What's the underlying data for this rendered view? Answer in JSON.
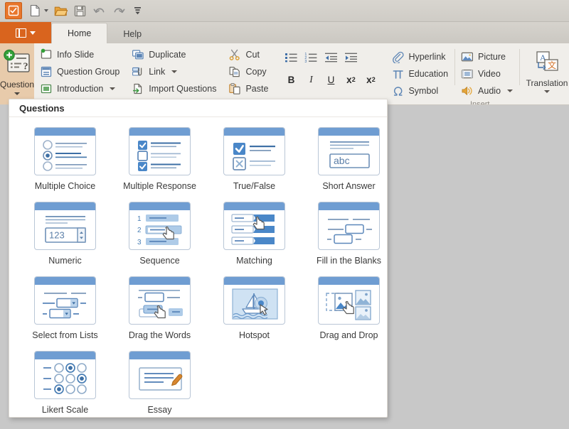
{
  "quick_access": {
    "app_icon": "checkbox-app-icon",
    "items": [
      {
        "name": "new",
        "icon": "new-document-icon",
        "has_caret": true
      },
      {
        "name": "open",
        "icon": "open-folder-icon",
        "has_caret": false
      },
      {
        "name": "save",
        "icon": "save-floppy-icon",
        "has_caret": false
      },
      {
        "name": "undo",
        "icon": "undo-arrow-icon",
        "has_caret": false
      },
      {
        "name": "redo",
        "icon": "redo-arrow-icon",
        "has_caret": false
      },
      {
        "name": "customize",
        "icon": "customize-toolbar-icon",
        "has_caret": false
      }
    ]
  },
  "tabs": {
    "file_menu_label": "",
    "items": [
      {
        "label": "Home",
        "active": true
      },
      {
        "label": "Help",
        "active": false
      }
    ]
  },
  "ribbon": {
    "question_button": {
      "label": "Question",
      "icon": "add-question-icon"
    },
    "slide_group": [
      {
        "label": "Info Slide",
        "icon": "info-slide-icon",
        "caret": false
      },
      {
        "label": "Question Group",
        "icon": "question-group-icon",
        "caret": false
      },
      {
        "label": "Introduction",
        "icon": "introduction-icon",
        "caret": true
      }
    ],
    "edit_group": [
      {
        "label": "Duplicate",
        "icon": "duplicate-icon",
        "caret": false
      },
      {
        "label": "Link",
        "icon": "link-icon",
        "caret": true
      },
      {
        "label": "Import Questions",
        "icon": "import-questions-icon",
        "caret": false
      }
    ],
    "clipboard_group": [
      {
        "label": "Cut",
        "icon": "scissors-icon",
        "caret": false
      },
      {
        "label": "Copy",
        "icon": "copy-icon",
        "caret": false
      },
      {
        "label": "Paste",
        "icon": "paste-icon",
        "caret": false
      }
    ],
    "format_group": {
      "paragraph_row": [
        {
          "name": "bullet-list",
          "icon": "bullet-list-icon"
        },
        {
          "name": "numbered-list",
          "icon": "numbered-list-icon"
        },
        {
          "name": "decrease-indent",
          "icon": "decrease-indent-icon"
        },
        {
          "name": "increase-indent",
          "icon": "increase-indent-icon"
        }
      ],
      "font_row": [
        {
          "name": "bold",
          "label": "B"
        },
        {
          "name": "italic",
          "label": "I"
        },
        {
          "name": "underline",
          "label": "U"
        },
        {
          "name": "subscript",
          "label": "x",
          "script": "2"
        },
        {
          "name": "superscript",
          "label": "x",
          "script": "2"
        }
      ]
    },
    "insert_group": {
      "label": "Insert",
      "column_one": [
        {
          "label": "Hyperlink",
          "icon": "paperclip-icon",
          "caret": false
        },
        {
          "label": "Education",
          "icon": "pi-icon",
          "caret": false
        },
        {
          "label": "Symbol",
          "icon": "omega-icon",
          "caret": false
        }
      ],
      "column_two": [
        {
          "label": "Picture",
          "icon": "picture-icon",
          "caret": false
        },
        {
          "label": "Video",
          "icon": "video-icon",
          "caret": false
        },
        {
          "label": "Audio",
          "icon": "audio-icon",
          "caret": true
        }
      ],
      "translation_button": {
        "label": "Translation",
        "icon": "translation-icon"
      }
    }
  },
  "gallery": {
    "title": "Questions",
    "items": [
      {
        "label": "Multiple Choice",
        "icon": "multiple-choice-thumb"
      },
      {
        "label": "Multiple Response",
        "icon": "multiple-response-thumb"
      },
      {
        "label": "True/False",
        "icon": "true-false-thumb"
      },
      {
        "label": "Short Answer",
        "icon": "short-answer-thumb",
        "sample_text": "abc"
      },
      {
        "label": "Numeric",
        "icon": "numeric-thumb",
        "sample_text": "123"
      },
      {
        "label": "Sequence",
        "icon": "sequence-thumb",
        "numbers": [
          "1",
          "2",
          "3"
        ]
      },
      {
        "label": "Matching",
        "icon": "matching-thumb"
      },
      {
        "label": "Fill in the Blanks",
        "icon": "fill-in-the-blanks-thumb"
      },
      {
        "label": "Select from Lists",
        "icon": "select-from-lists-thumb"
      },
      {
        "label": "Drag the Words",
        "icon": "drag-the-words-thumb"
      },
      {
        "label": "Hotspot",
        "icon": "hotspot-thumb"
      },
      {
        "label": "Drag and Drop",
        "icon": "drag-and-drop-thumb"
      },
      {
        "label": "Likert Scale",
        "icon": "likert-scale-thumb"
      },
      {
        "label": "Essay",
        "icon": "essay-thumb"
      }
    ]
  },
  "colors": {
    "accent_orange": "#d9641e",
    "app_orange": "#e8762c",
    "ribbon_bg": "#f0eeea",
    "chrome_bg": "#d4d0c8",
    "canvas_bg": "#c8c8c8",
    "thumb_blue": "#6f9dd2",
    "thumb_fill": "#4a87c8",
    "icon_blue": "#4a7fb5",
    "question_btn_bg": "#e8cbab"
  }
}
